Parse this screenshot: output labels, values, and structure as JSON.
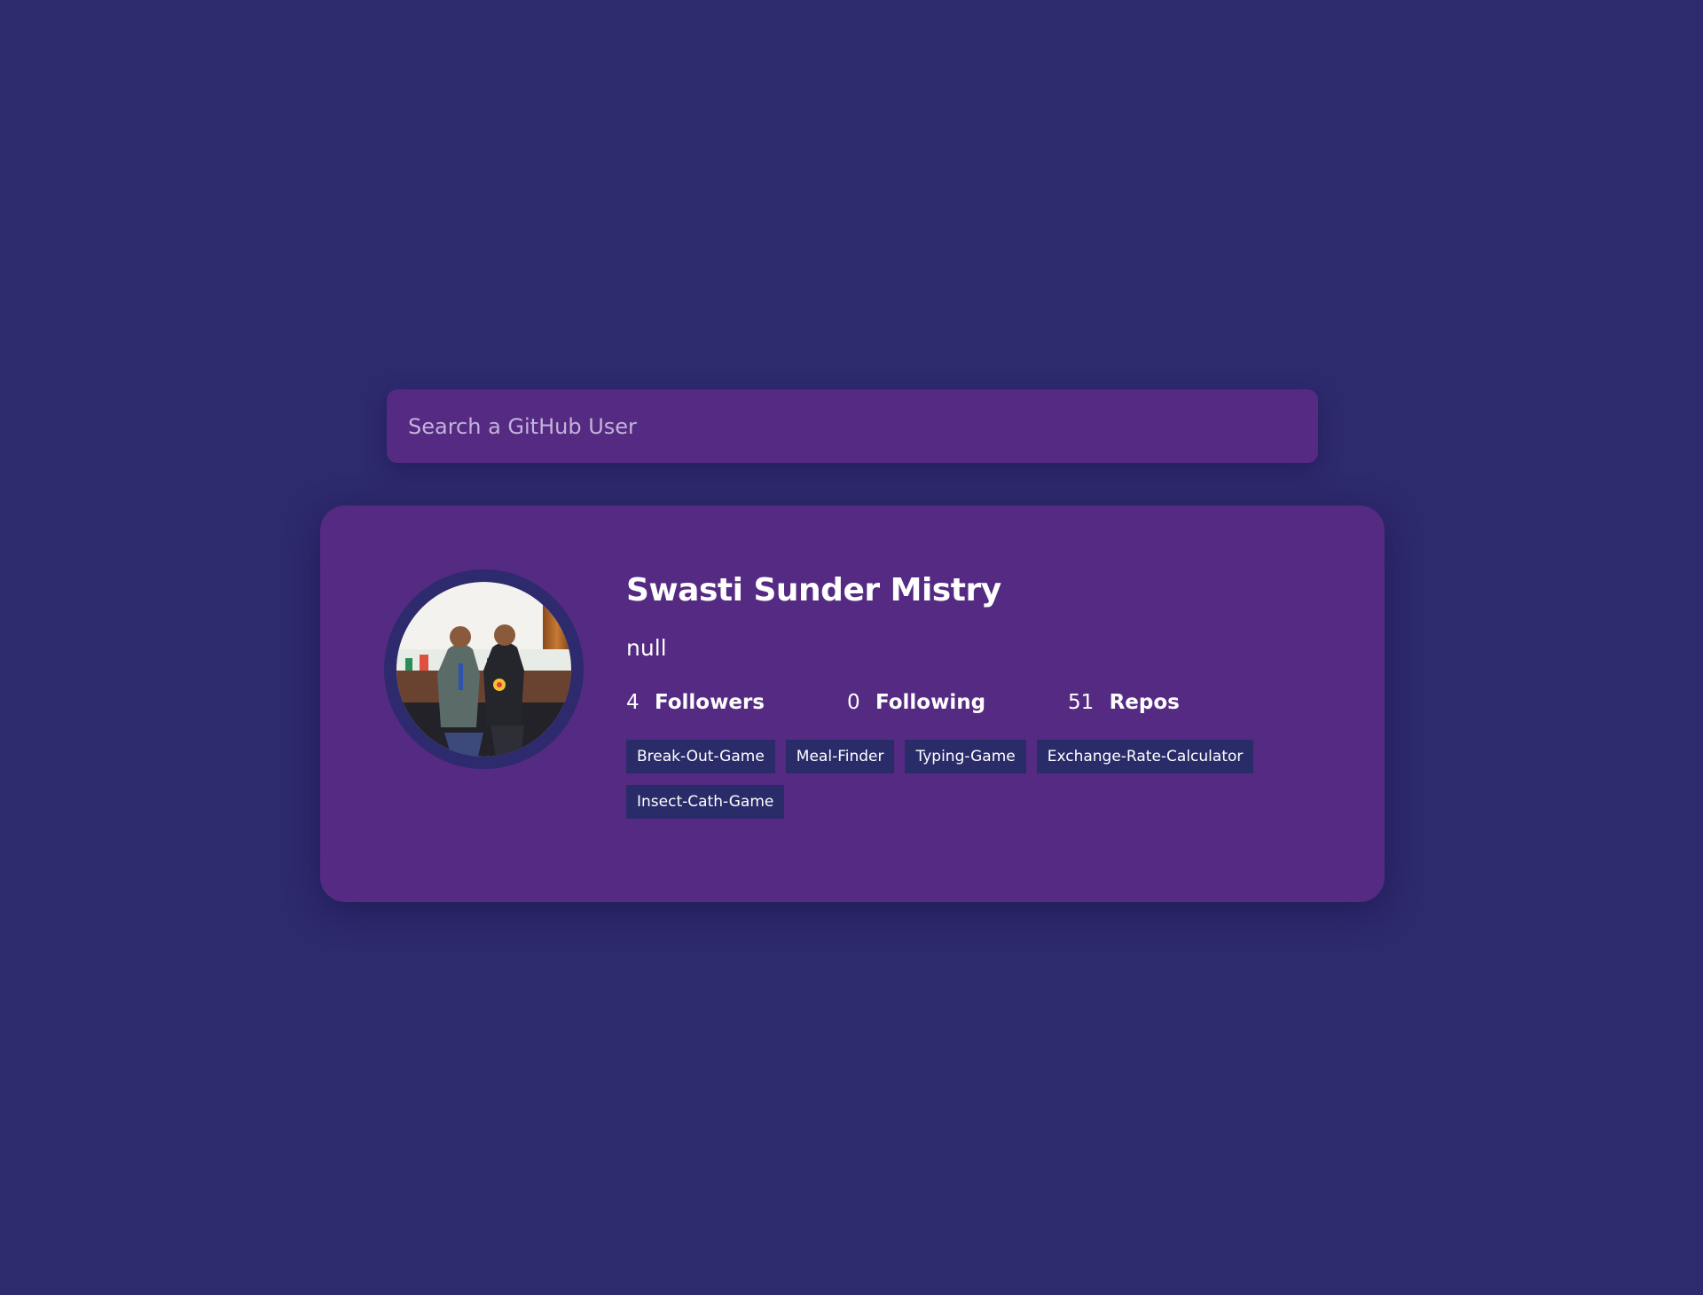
{
  "search": {
    "placeholder": "Search a GitHub User",
    "value": ""
  },
  "profile": {
    "name": "Swasti Sunder Mistry",
    "bio": "null",
    "avatar_alt": "Swasti Sunder Mistry avatar",
    "stats": {
      "followers": {
        "count": "4",
        "label": "Followers"
      },
      "following": {
        "count": "0",
        "label": "Following"
      },
      "repos": {
        "count": "51",
        "label": "Repos"
      }
    },
    "repos": [
      "Break-Out-Game",
      "Meal-Finder",
      "Typing-Game",
      "Exchange-Rate-Calculator",
      "Insect-Cath-Game"
    ]
  },
  "colors": {
    "background": "#2d2a6e",
    "card": "#552a82",
    "repo_tag": "#2a2b69",
    "text": "#ffffff"
  }
}
